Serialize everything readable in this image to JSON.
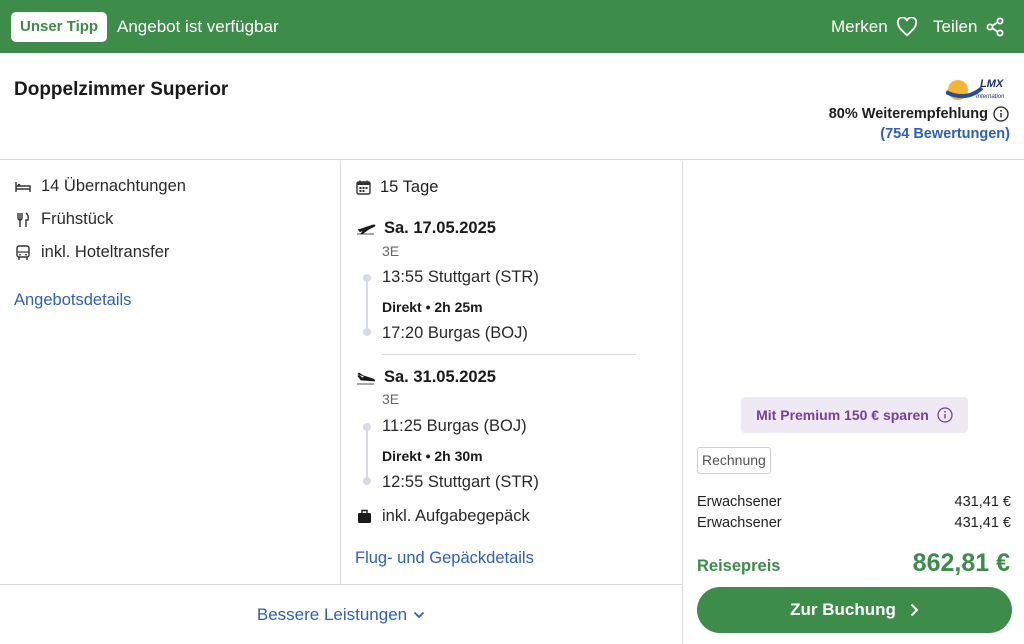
{
  "topbar": {
    "badge": "Unser Tipp",
    "status": "Angebot ist verfügbar",
    "save_label": "Merken",
    "share_label": "Teilen"
  },
  "header": {
    "room": "Doppelzimmer Superior",
    "logo_text": "LMX International",
    "recommendation": "80% Weiterempfehlung",
    "reviews": "(754 Bewertungen)"
  },
  "features": {
    "nights": "14 Übernachtungen",
    "board": "Frühstück",
    "transfer": "inkl. Hoteltransfer",
    "details_link": "Angebotsdetails"
  },
  "flights": {
    "duration": "15 Tage",
    "outbound": {
      "date": "Sa. 17.05.2025",
      "class": "3E",
      "dep": "13:55 Stuttgart (STR)",
      "direct": "Direkt • 2h 25m",
      "arr": "17:20 Burgas (BOJ)"
    },
    "return": {
      "date": "Sa. 31.05.2025",
      "class": "3E",
      "dep": "11:25 Burgas (BOJ)",
      "direct": "Direkt • 2h 30m",
      "arr": "12:55 Stuttgart (STR)"
    },
    "baggage": "inkl. Aufgabegepäck",
    "details_link": "Flug- und Gepäckdetails"
  },
  "pricing": {
    "premium": "Mit Premium 150 € sparen",
    "invoice": "Rechnung",
    "passengers": [
      {
        "label": "Erwachsener",
        "price": "431,41 €"
      },
      {
        "label": "Erwachsener",
        "price": "431,41 €"
      }
    ],
    "total_label": "Reisepreis",
    "total": "862,81 €",
    "book_button": "Zur Buchung"
  },
  "footer": {
    "more": "Bessere Leistungen"
  },
  "colors": {
    "brand_green": "#3d8c4a",
    "link_blue": "#2f5fbd",
    "premium_purple": "#7a3f9d"
  }
}
